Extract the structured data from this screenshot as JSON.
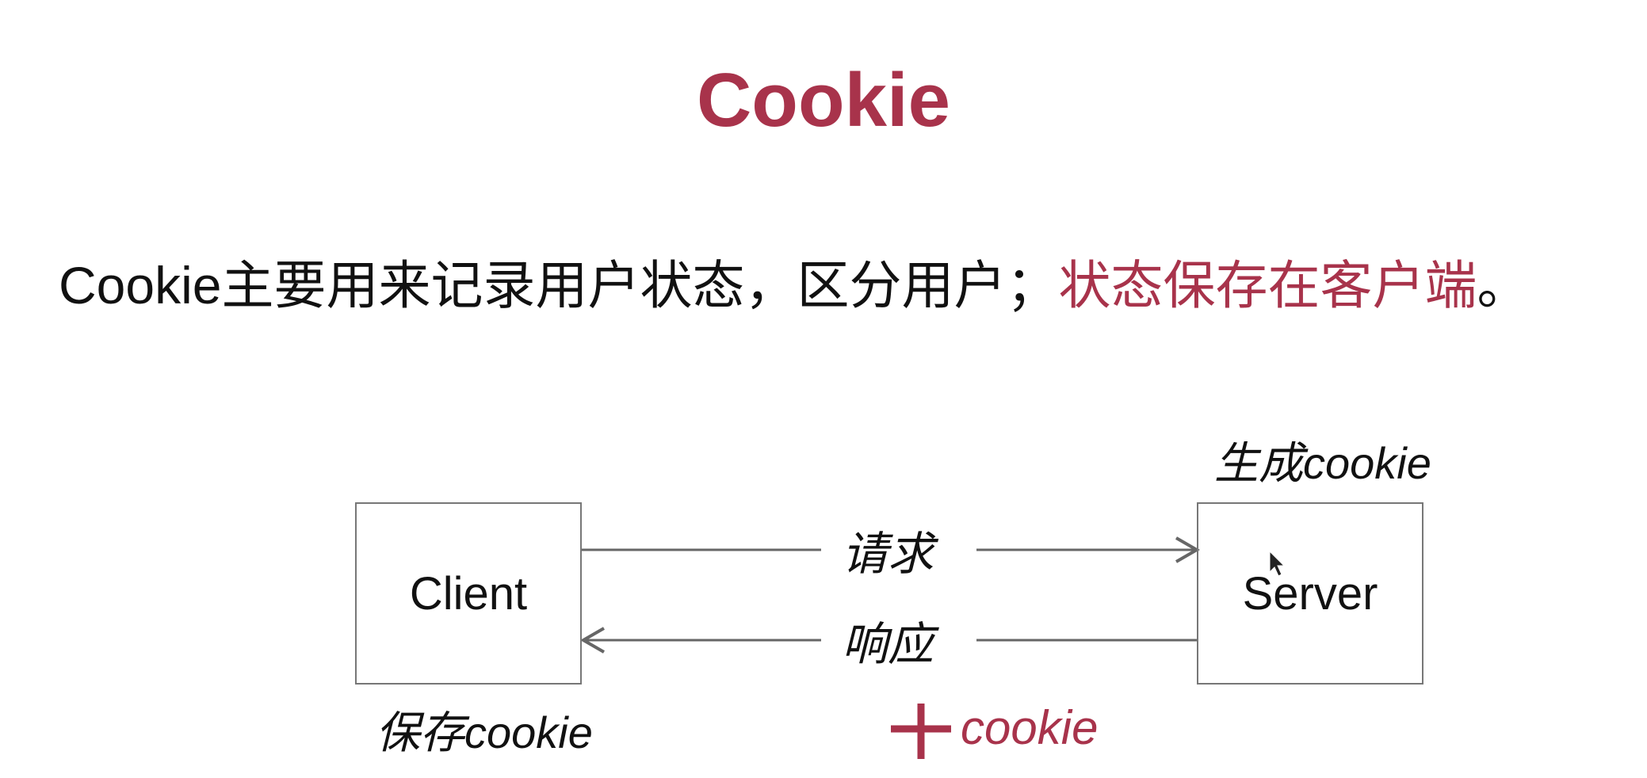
{
  "title": "Cookie",
  "description": {
    "main": "Cookie主要用来记录用户状态，区分用户；",
    "highlight": "状态保存在客户端",
    "end": "。"
  },
  "diagram": {
    "client_label": "Client",
    "server_label": "Server",
    "request_label": "请求",
    "response_label": "响应",
    "server_note": "生成cookie",
    "client_note": "保存cookie",
    "response_extra": "cookie"
  },
  "colors": {
    "accent": "#a8334b",
    "text": "#111111",
    "line": "#666666"
  }
}
